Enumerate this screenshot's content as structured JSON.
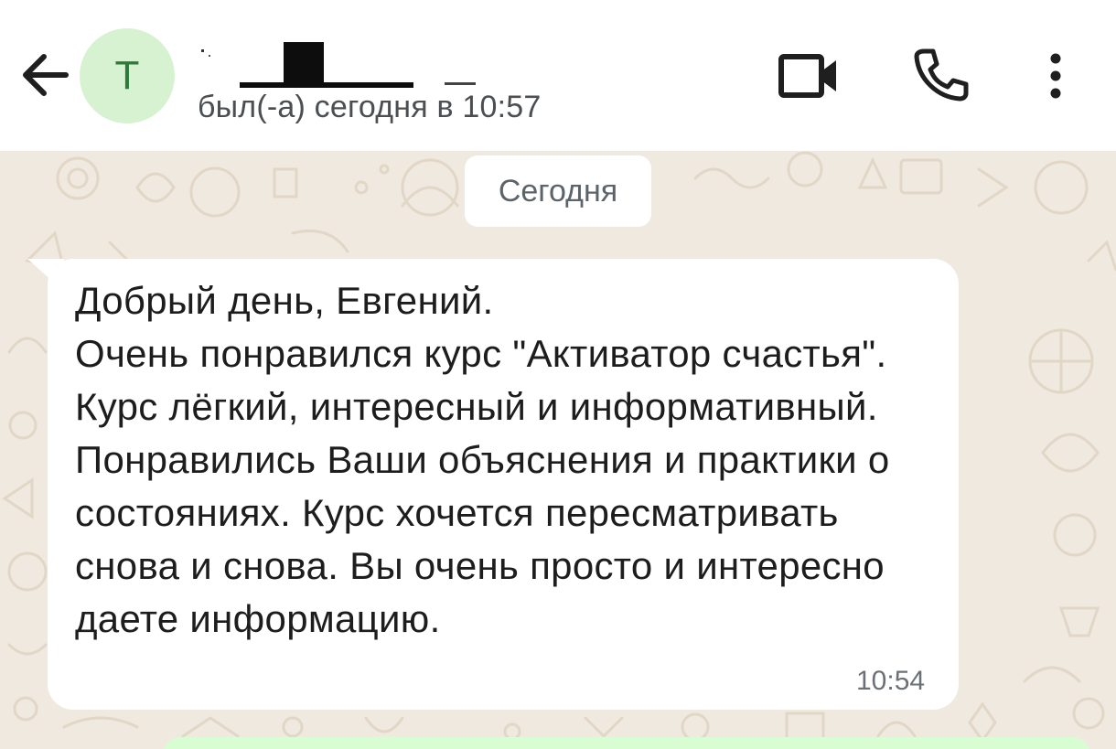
{
  "header": {
    "avatar_letter": "Т",
    "status": "был(-а) сегодня в 10:57",
    "icons": [
      "back-arrow-icon",
      "video-call-icon",
      "phone-icon",
      "more-vert-icon"
    ]
  },
  "chat": {
    "date_separator": "Сегодня",
    "messages": [
      {
        "direction": "incoming",
        "text": "Добрый день, Евгений.\nОчень понравился курс \"Активатор счастья\". Курс лёгкий, интересный и информативный.  Понравились Ваши объяснения и практики о состояниях. Курс хочется пересматривать снова и снова. Вы очень просто и интересно даете информацию.",
        "time": "10:54"
      }
    ]
  },
  "colors": {
    "chat_background": "#efe9df",
    "incoming_bubble": "#ffffff",
    "outgoing_bubble": "#d9fdd3",
    "avatar_background": "#d7f2d1",
    "avatar_text": "#2d7a3a"
  }
}
